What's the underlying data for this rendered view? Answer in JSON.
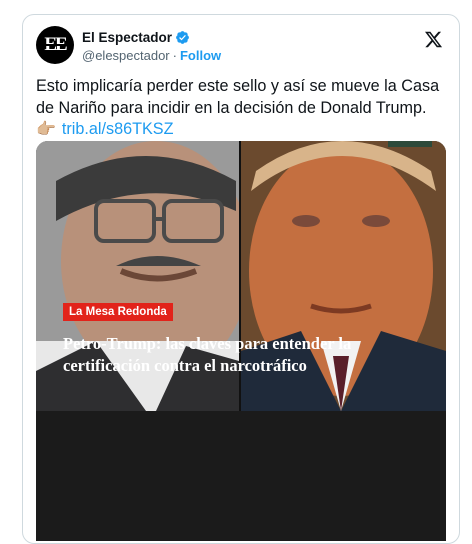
{
  "account": {
    "display_name": "El Espectador",
    "handle": "@elespectador",
    "separator": "·",
    "follow_label": "Follow",
    "avatar_text": "EE"
  },
  "tweet": {
    "text": "Esto implicaría perder este sello y así se mueve la Casa de Nariño para incidir en la decisión de Donald Trump.",
    "emoji": "👉🏼",
    "link_text": "trib.al/s86TKSZ"
  },
  "media": {
    "section_tag": "La Mesa Redonda",
    "headline": "Petro-Trump: las claves para entender la certificación contra el narcotráfico"
  },
  "colors": {
    "accent_blue": "#1d9bf0",
    "tag_red": "#e2231a",
    "text_primary": "#0f1419",
    "text_secondary": "#536471"
  },
  "icons": [
    "verified-badge-icon",
    "x-logo-icon",
    "pointing-hand-emoji"
  ]
}
